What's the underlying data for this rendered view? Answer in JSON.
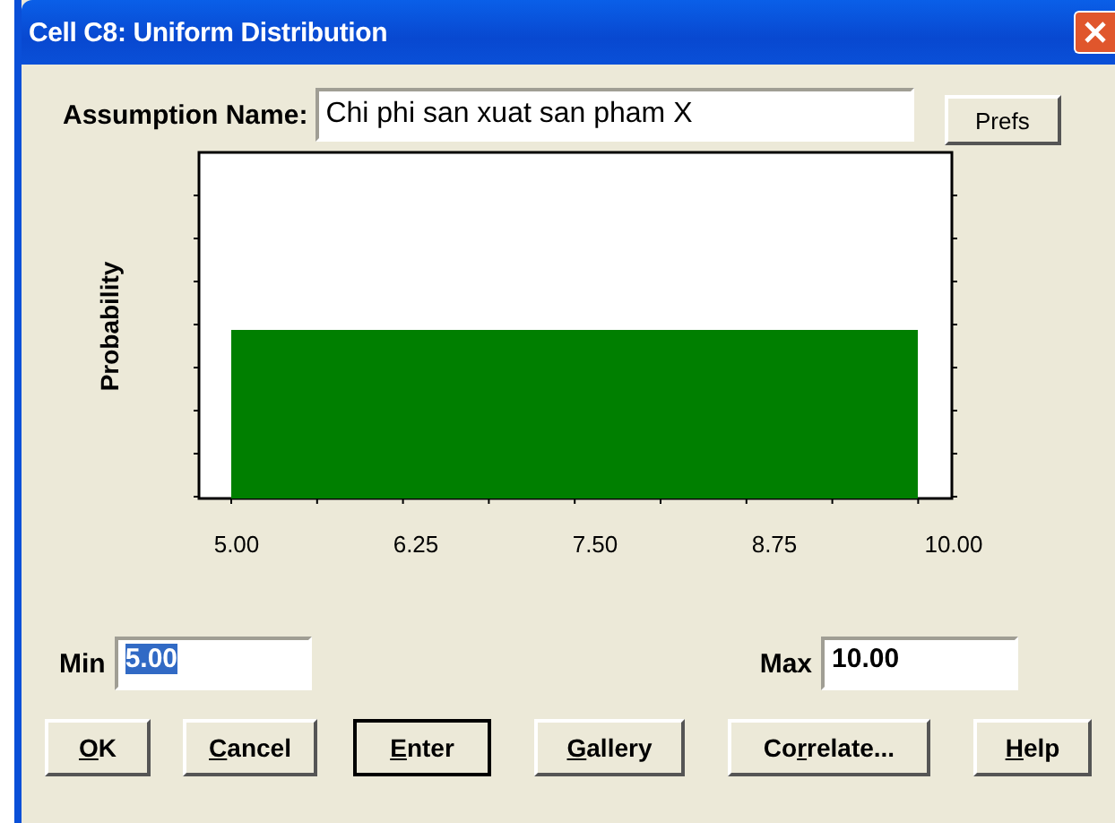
{
  "window": {
    "title": "Cell C8:  Uniform Distribution"
  },
  "assumption": {
    "label": "Assumption Name:",
    "value": "Chi phi san xuat san pham X"
  },
  "prefs_button": "Prefs",
  "plot": {
    "ylabel": "Probability",
    "x_labels": [
      "5.00",
      "6.25",
      "7.50",
      "8.75",
      "10.00"
    ]
  },
  "min": {
    "label": "Min",
    "value": "5.00",
    "highlighted": true
  },
  "max": {
    "label": "Max",
    "value": "10.00",
    "highlighted": false
  },
  "buttons": [
    {
      "key": "O",
      "after": "K",
      "default": false
    },
    {
      "key": "C",
      "after": "ancel",
      "default": false
    },
    {
      "key": "E",
      "after": "nter",
      "default": true
    },
    {
      "key": "G",
      "after": "allery",
      "default": false
    },
    {
      "before": "Co",
      "key": "r",
      "after": "relate...",
      "default": false
    },
    {
      "key": "H",
      "after": "elp",
      "default": false
    }
  ]
}
